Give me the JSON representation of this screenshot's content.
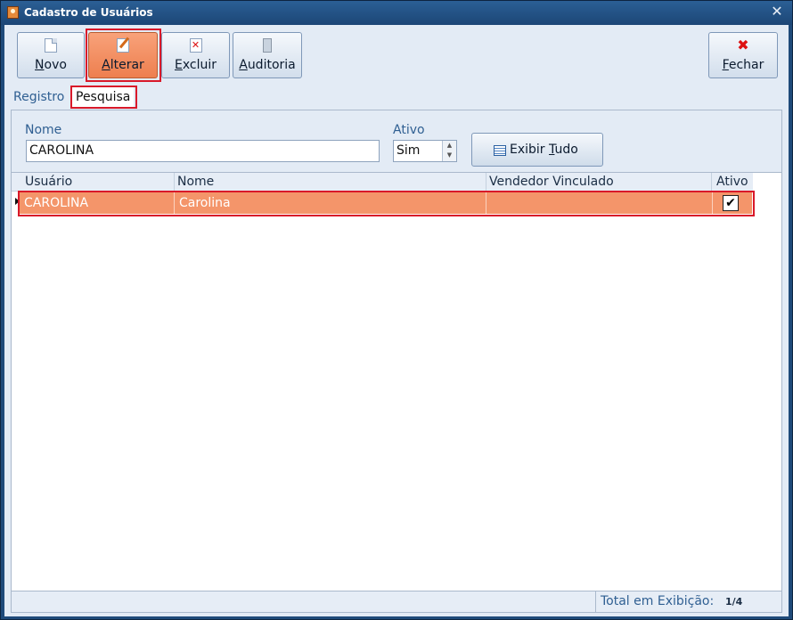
{
  "window": {
    "title": "Cadastro de Usuários"
  },
  "toolbar": {
    "novo": {
      "mnemonic": "N",
      "rest": "ovo"
    },
    "alterar": {
      "mnemonic": "A",
      "rest": "lterar"
    },
    "excluir": {
      "mnemonic": "E",
      "rest": "xcluir"
    },
    "auditoria": {
      "mnemonic": "A",
      "rest": "uditoria"
    },
    "fechar": {
      "mnemonic": "F",
      "rest": "echar"
    }
  },
  "tabs": [
    {
      "label": "Registro",
      "selected": false
    },
    {
      "label": "Pesquisa",
      "selected": true
    }
  ],
  "filters": {
    "nome_label": "Nome",
    "nome_value": "CAROLINA",
    "ativo_label": "Ativo",
    "ativo_value": "Sim",
    "exibir_prefix": "Exibir ",
    "exibir_mnemonic": "T",
    "exibir_rest": "udo"
  },
  "grid": {
    "columns": [
      "Usuário",
      "Nome",
      "Vendedor Vinculado",
      "Ativo"
    ],
    "rows": [
      {
        "usuario": "CAROLINA",
        "nome": "Carolina",
        "vendedor": "",
        "ativo": true
      }
    ]
  },
  "status": {
    "label": "Total em Exibição:",
    "value": "1/4"
  },
  "colors": {
    "selected_row": "#f4956a",
    "highlight": "#d9192a",
    "accent_active": "#ee7f4f"
  },
  "icons": [
    "app-icon",
    "new-document-icon",
    "edit-document-icon",
    "delete-document-icon",
    "audit-icon",
    "close-icon",
    "list-icon",
    "checkbox-icon",
    "row-indicator-icon"
  ]
}
